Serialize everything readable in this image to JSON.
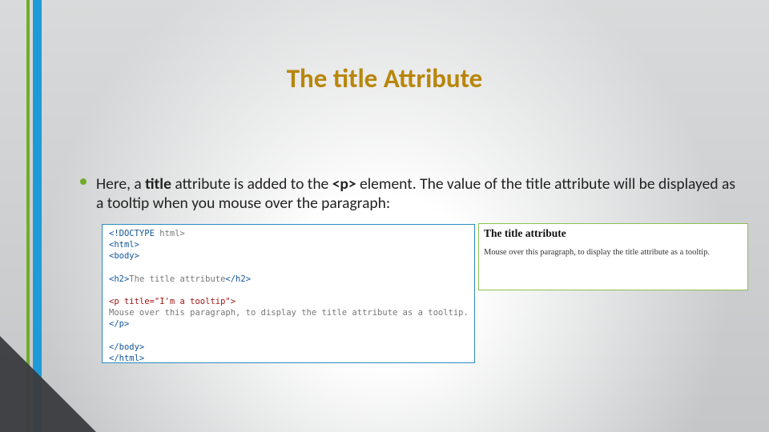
{
  "title": "The title Attribute",
  "bullet": {
    "pre": "Here, a ",
    "bold1": "title",
    "mid1": " attribute is added to the ",
    "bold2": "<p>",
    "mid2": " element. The value of the title attribute will be displayed as a tooltip when you mouse over the paragraph:"
  },
  "code": {
    "l1a": "<!DOCTYPE",
    "l1b": " html>",
    "l2": "<html>",
    "l3": "<body>",
    "l4a": "<h2>",
    "l4b": "The title attribute",
    "l4c": "</h2>",
    "l5a": "<p",
    "l5b": " title",
    "l5c": "=\"I'm a tooltip\">",
    "l6": "Mouse over this paragraph, to display the title attribute as a tooltip.",
    "l7": "</p>",
    "l8": "</body>",
    "l9": "</html>"
  },
  "output": {
    "heading": "The title attribute",
    "paragraph": "Mouse over this paragraph, to display the title attribute as a tooltip."
  }
}
